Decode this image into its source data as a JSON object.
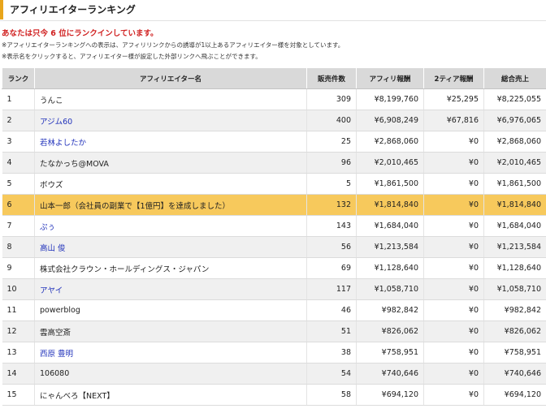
{
  "header": {
    "title": "アフィリエイターランキング"
  },
  "notice": "あなたは只今 6 位にランクインしています。",
  "notes": [
    "※アフィリエイターランキングへの表示は、アフィリリンクからの誘導が1以上あるアフィリエイター様を対象としています。",
    "※表示名をクリックすると、アフィリエイター様が設定した外部リンクへ飛ぶことができます。"
  ],
  "colors": {
    "accent": "#e8a51b",
    "highlight_row": "#f7c95c",
    "notice_text": "#d02020",
    "link": "#2233bb"
  },
  "table": {
    "columns": [
      "ランク",
      "アフィリエイター名",
      "販売件数",
      "アフィリ報酬",
      "2ティア報酬",
      "総合売上"
    ],
    "rows": [
      {
        "rank": "1",
        "name": "うんこ",
        "link": false,
        "sales": "309",
        "affiliate": "¥8,199,760",
        "tier2": "¥25,295",
        "total": "¥8,225,055"
      },
      {
        "rank": "2",
        "name": "アジム60",
        "link": true,
        "sales": "400",
        "affiliate": "¥6,908,249",
        "tier2": "¥67,816",
        "total": "¥6,976,065"
      },
      {
        "rank": "3",
        "name": "若林よしたか",
        "link": true,
        "sales": "25",
        "affiliate": "¥2,868,060",
        "tier2": "¥0",
        "total": "¥2,868,060"
      },
      {
        "rank": "4",
        "name": "たなかっち@MOVA",
        "link": false,
        "sales": "96",
        "affiliate": "¥2,010,465",
        "tier2": "¥0",
        "total": "¥2,010,465"
      },
      {
        "rank": "5",
        "name": "ボウズ",
        "link": false,
        "sales": "5",
        "affiliate": "¥1,861,500",
        "tier2": "¥0",
        "total": "¥1,861,500"
      },
      {
        "rank": "6",
        "name": "山本一郎（会社員の副業で【1億円】を達成しました）",
        "link": false,
        "sales": "132",
        "affiliate": "¥1,814,840",
        "tier2": "¥0",
        "total": "¥1,814,840",
        "highlight": true
      },
      {
        "rank": "7",
        "name": "ぷぅ",
        "link": true,
        "sales": "143",
        "affiliate": "¥1,684,040",
        "tier2": "¥0",
        "total": "¥1,684,040"
      },
      {
        "rank": "8",
        "name": "高山 俊",
        "link": true,
        "sales": "56",
        "affiliate": "¥1,213,584",
        "tier2": "¥0",
        "total": "¥1,213,584"
      },
      {
        "rank": "9",
        "name": "株式会社クラウン・ホールディングス・ジャパン",
        "link": false,
        "sales": "69",
        "affiliate": "¥1,128,640",
        "tier2": "¥0",
        "total": "¥1,128,640"
      },
      {
        "rank": "10",
        "name": "アヤイ",
        "link": true,
        "sales": "117",
        "affiliate": "¥1,058,710",
        "tier2": "¥0",
        "total": "¥1,058,710"
      },
      {
        "rank": "11",
        "name": "powerblog",
        "link": false,
        "sales": "46",
        "affiliate": "¥982,842",
        "tier2": "¥0",
        "total": "¥982,842"
      },
      {
        "rank": "12",
        "name": "雲高空斎",
        "link": false,
        "sales": "51",
        "affiliate": "¥826,062",
        "tier2": "¥0",
        "total": "¥826,062"
      },
      {
        "rank": "13",
        "name": "西原 豊明",
        "link": true,
        "sales": "38",
        "affiliate": "¥758,951",
        "tier2": "¥0",
        "total": "¥758,951"
      },
      {
        "rank": "14",
        "name": "106080",
        "link": false,
        "sales": "54",
        "affiliate": "¥740,646",
        "tier2": "¥0",
        "total": "¥740,646"
      },
      {
        "rank": "15",
        "name": "にゃんべろ【NEXT】",
        "link": false,
        "sales": "58",
        "affiliate": "¥694,120",
        "tier2": "¥0",
        "total": "¥694,120"
      }
    ]
  }
}
